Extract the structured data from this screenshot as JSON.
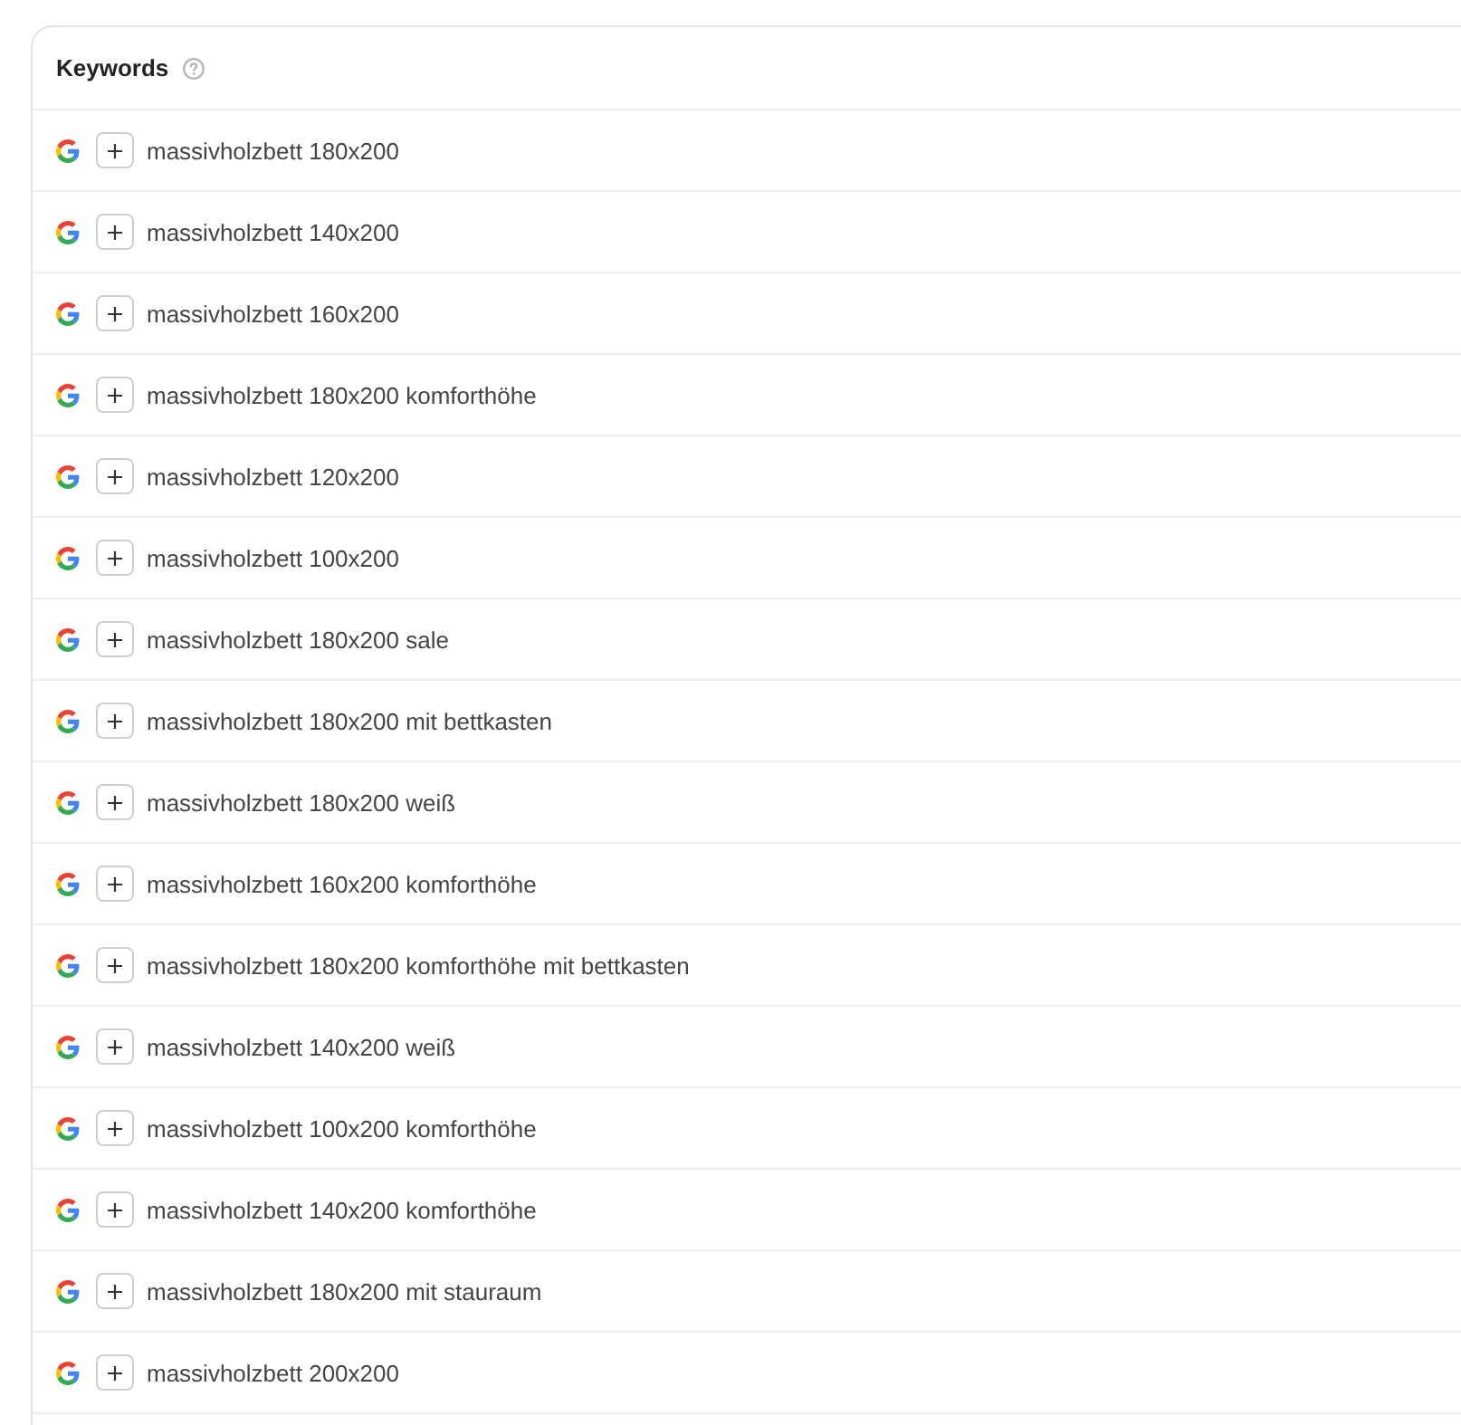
{
  "keywords_panel": {
    "title": "Keywords",
    "keywords": [
      "massivholzbett 180x200",
      "massivholzbett 140x200",
      "massivholzbett 160x200",
      "massivholzbett 180x200 komforthöhe",
      "massivholzbett 120x200",
      "massivholzbett 100x200",
      "massivholzbett 180x200 sale",
      "massivholzbett 180x200 mit bettkasten",
      "massivholzbett 180x200 weiß",
      "massivholzbett 160x200 komforthöhe",
      "massivholzbett 180x200 komforthöhe mit bettkasten",
      "massivholzbett 140x200 weiß",
      "massivholzbett 100x200 komforthöhe",
      "massivholzbett 140x200 komforthöhe",
      "massivholzbett 180x200 mit stauraum",
      "massivholzbett 200x200"
    ]
  }
}
